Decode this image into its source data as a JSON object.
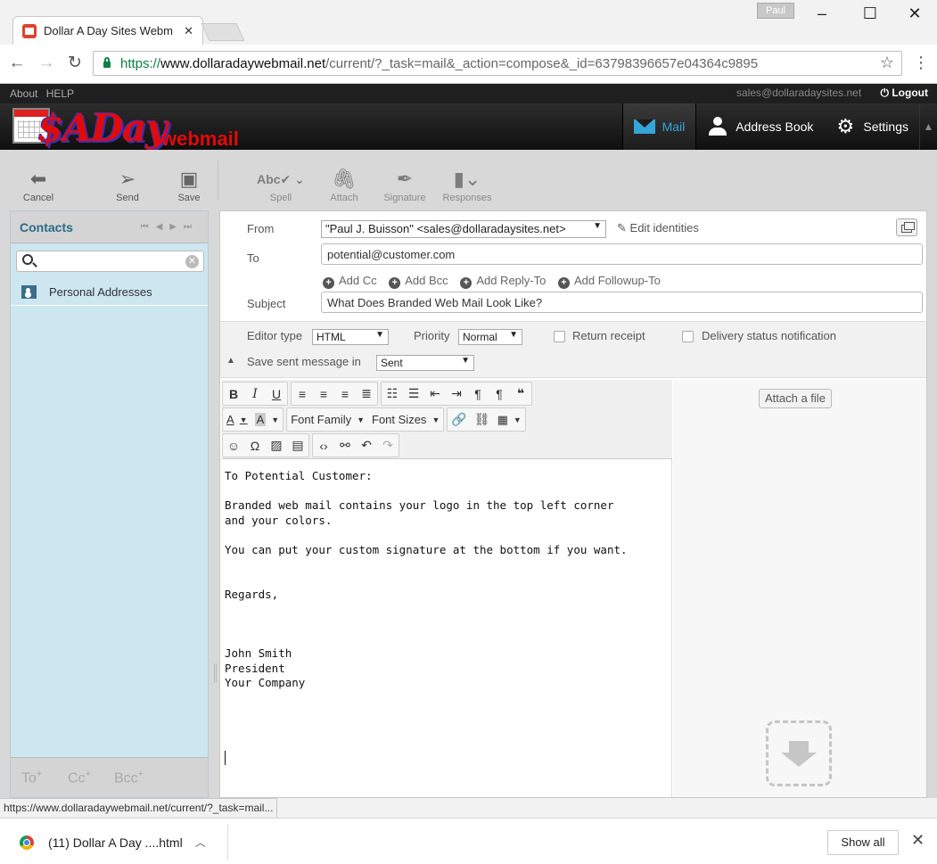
{
  "browser": {
    "tab_title": "Dollar A Day Sites Webm",
    "tab_close": "✕",
    "profile": "Paul",
    "url_scheme": "https://",
    "url_host": "www.dollaradaywebmail.net",
    "url_path": "/current/?_task=mail&_action=compose&_id=63798396657e04364c9895",
    "status_url": "https://www.dollaradaywebmail.net/current/?_task=mail...",
    "window_controls": {
      "minimize": "–",
      "maximize": "☐",
      "close": "✕"
    }
  },
  "topline": {
    "about": "About",
    "help": "HELP",
    "user_email": "sales@dollaradaysites.net",
    "logout": "Logout"
  },
  "logo": {
    "brand": "$ADay",
    "suffix": "webmail"
  },
  "topnav": [
    {
      "label": "Mail",
      "icon": "mail-icon",
      "selected": true
    },
    {
      "label": "Address Book",
      "icon": "address-book-icon",
      "selected": false
    },
    {
      "label": "Settings",
      "icon": "gear-icon",
      "selected": false
    }
  ],
  "toolbar": {
    "cancel": "Cancel",
    "send": "Send",
    "save": "Save",
    "spell": "Spell",
    "attach": "Attach",
    "signature": "Signature",
    "responses": "Responses"
  },
  "contacts": {
    "title": "Contacts",
    "search_value": "",
    "address_book": "Personal Addresses",
    "footer": {
      "to": "To",
      "cc": "Cc",
      "bcc": "Bcc"
    }
  },
  "compose": {
    "from_label": "From",
    "from_value": "\"Paul J. Buisson\" <sales@dollaradaysites.net>",
    "edit_identities": "Edit identities",
    "to_label": "To",
    "to_value": "potential@customer.com",
    "add_links": [
      "Add Cc",
      "Add Bcc",
      "Add Reply-To",
      "Add Followup-To"
    ],
    "subject_label": "Subject",
    "subject_value": "What Does Branded Web Mail Look Like?",
    "editor_type_label": "Editor type",
    "editor_type_value": "HTML",
    "priority_label": "Priority",
    "priority_value": "Normal",
    "return_receipt": "Return receipt",
    "delivery_status": "Delivery status notification",
    "save_sent_label": "Save sent message in",
    "save_sent_value": "Sent",
    "attach_file": "Attach a file"
  },
  "editor": {
    "font_family": "Font Family",
    "font_sizes": "Font Sizes",
    "body": "To Potential Customer:\n\nBranded web mail contains your logo in the top left corner\nand your colors.\n\nYou can put your custom signature at the bottom if you want.\n\n\nRegards,\n\n\n\nJohn Smith\nPresident\nYour Company"
  },
  "download_shelf": {
    "item": "(11) Dollar A Day ....html",
    "show_all": "Show all"
  },
  "colors": {
    "accent": "#35a5d8",
    "brand_red": "#e10a0a",
    "panel_blue": "#cde6f0",
    "header_dark": "#1f1f1f"
  }
}
